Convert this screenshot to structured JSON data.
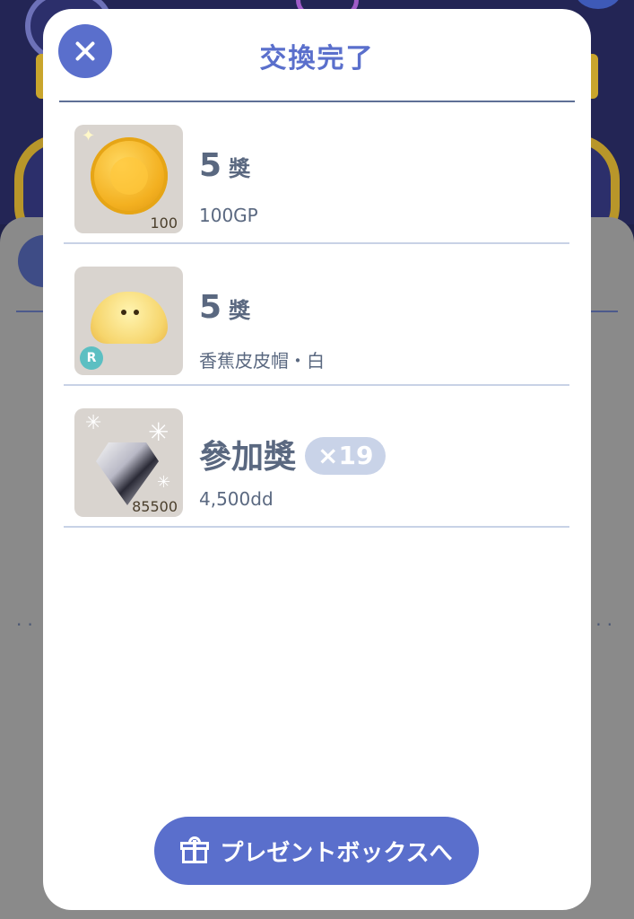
{
  "modal": {
    "title": "交換完了",
    "close_icon": "close-icon"
  },
  "rewards": [
    {
      "name_main": "5",
      "name_suffix": "獎",
      "description": "100GP",
      "thumb_value": "100",
      "icon": "gold-coin-icon"
    },
    {
      "name_main": "5",
      "name_suffix": "獎",
      "description": "香蕉皮皮帽・白",
      "rarity": "R",
      "icon": "banana-hat-icon"
    },
    {
      "name_main": "參加獎",
      "quantity": "×19",
      "description": "4,500dd",
      "thumb_value": "85500",
      "icon": "diamond-icon"
    }
  ],
  "footer": {
    "present_button_label": "プレゼントボックスへ",
    "present_button_icon": "gift-icon"
  },
  "colors": {
    "accent": "#5a6fcc",
    "text": "#5a6880",
    "divider": "#c8d2e6",
    "quantity_badge": "#c9d3e8"
  }
}
